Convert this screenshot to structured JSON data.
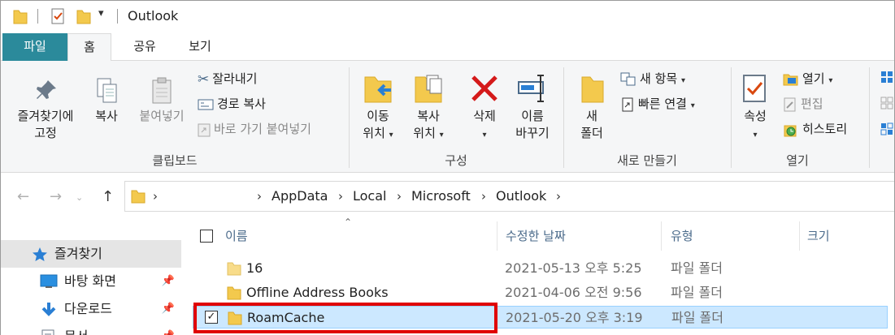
{
  "window": {
    "title": "Outlook"
  },
  "tabs": [
    {
      "id": "file",
      "label": "파일"
    },
    {
      "id": "home",
      "label": "홈"
    },
    {
      "id": "share",
      "label": "공유"
    },
    {
      "id": "view",
      "label": "보기"
    }
  ],
  "ribbon": {
    "clipboard": {
      "group_label": "클립보드",
      "pin_line1": "즐겨찾기에",
      "pin_line2": "고정",
      "copy": "복사",
      "paste": "붙여넣기",
      "cut": "잘라내기",
      "copy_path": "경로 복사",
      "paste_shortcut": "바로 가기 붙여넣기"
    },
    "organize": {
      "group_label": "구성",
      "move_line1": "이동",
      "move_line2": "위치",
      "copyto_line1": "복사",
      "copyto_line2": "위치",
      "delete": "삭제",
      "rename_line1": "이름",
      "rename_line2": "바꾸기"
    },
    "new": {
      "group_label": "새로 만들기",
      "newfolder_line1": "새",
      "newfolder_line2": "폴더",
      "new_item": "새 항목",
      "easy_access": "빠른 연결"
    },
    "open": {
      "group_label": "열기",
      "properties": "속성",
      "open": "열기",
      "edit": "편집",
      "history": "히스토리"
    }
  },
  "address": {
    "crumbs": [
      "AppData",
      "Local",
      "Microsoft",
      "Outlook"
    ]
  },
  "nav_pane": {
    "items": [
      {
        "label": "즐겨찾기",
        "icon": "star-icon"
      },
      {
        "label": "바탕 화면",
        "icon": "desktop-icon"
      },
      {
        "label": "다운로드",
        "icon": "download-icon"
      },
      {
        "label": "문서",
        "icon": "document-icon"
      }
    ]
  },
  "file_list": {
    "columns": {
      "name": "이름",
      "modified": "수정한 날짜",
      "type": "유형",
      "size": "크기"
    },
    "rows": [
      {
        "name": "16",
        "modified": "2021-05-13 오후 5:25",
        "type": "파일 폴더",
        "selected": false
      },
      {
        "name": "Offline Address Books",
        "modified": "2021-04-06 오전 9:56",
        "type": "파일 폴더",
        "selected": false
      },
      {
        "name": "RoamCache",
        "modified": "2021-05-20 오후 3:19",
        "type": "파일 폴더",
        "selected": true
      }
    ]
  },
  "colors": {
    "file_tab": "#2b8a9b",
    "selection": "#cce8ff",
    "highlight_box": "#e00000",
    "folder": "#f3c94d"
  }
}
